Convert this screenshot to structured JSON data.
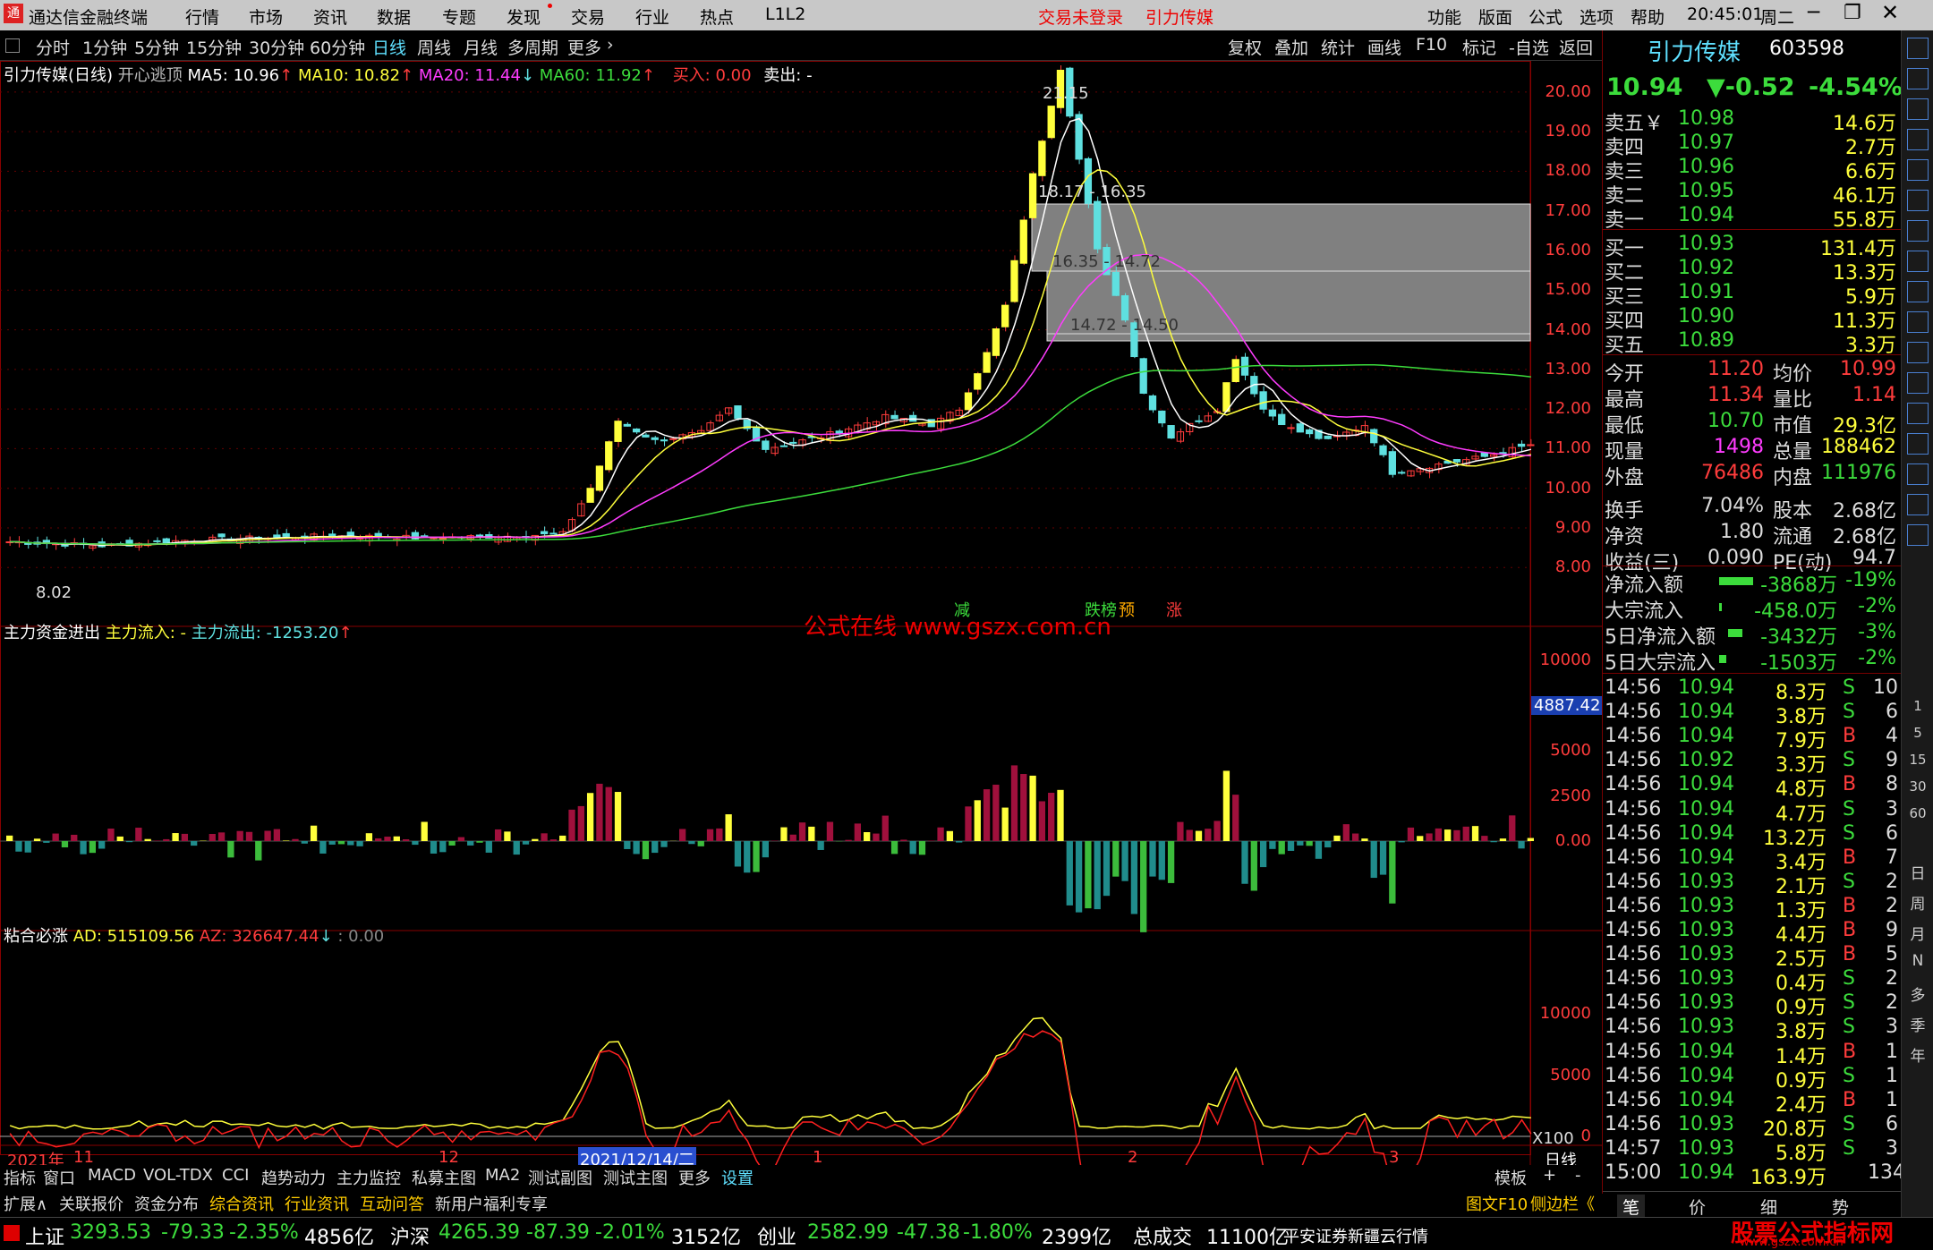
{
  "titlebar": {
    "app_title": "通达信金融终端",
    "menu": [
      "行情",
      "市场",
      "资讯",
      "数据",
      "专题",
      "发现",
      "交易",
      "行业",
      "热点",
      "L1L2"
    ],
    "login": "交易未登录",
    "stock_name": "引力传媒",
    "right_menu": [
      "功能",
      "版面",
      "公式",
      "选项",
      "帮助"
    ],
    "clock": "20:45:01",
    "weekday": "周二"
  },
  "period_tabs": [
    "分时",
    "1分钟",
    "5分钟",
    "15分钟",
    "30分钟",
    "60分钟",
    "日线",
    "周线",
    "月线",
    "多周期",
    "更多"
  ],
  "right_tabs": [
    "复权",
    "叠加",
    "统计",
    "画线",
    "F10",
    "标记",
    "-自选",
    "返回"
  ],
  "main_legend": {
    "name": "引力传媒(日线)",
    "formula": "开心逃顶",
    "ma5": "MA5: 10.96",
    "ma10": "MA10: 10.82",
    "ma20": "MA20: 11.44",
    "ma60": "MA60: 11.92",
    "buy": "买入: 0.00",
    "sell": "卖出: -"
  },
  "price_annotations": {
    "high": "21.15",
    "low": "8.02",
    "gap1": "18.17 - 16.35",
    "gap2": "16.35 - 14.72",
    "gap3": "14.72 - 14.50",
    "tag_jian": "减",
    "tag_die": "跌榜",
    "tag_yu": "预",
    "tag_zhang": "涨"
  },
  "price_axis": [
    "20.00",
    "19.00",
    "18.00",
    "17.00",
    "16.00",
    "15.00",
    "14.00",
    "13.00",
    "12.00",
    "11.00",
    "10.00",
    "9.00",
    "8.00"
  ],
  "watermark": "公式在线 www.gszx.com.cn",
  "sub1_legend": {
    "name": "主力资金进出",
    "inflow": "主力流入: -",
    "outflow": "主力流出: -1253.20"
  },
  "sub1_axis": [
    "10000",
    "7500",
    "5000",
    "2500",
    "0.00"
  ],
  "sub1_marker": "4887.42",
  "sub2_legend": {
    "name": "粘合必涨",
    "ad": "AD: 515109.56",
    "az": "AZ: 326647.44",
    "extra": ": 0.00"
  },
  "sub2_axis": [
    "10000",
    "5000",
    "0"
  ],
  "sub2_scale": "X100",
  "date_axis": {
    "year": "2021年",
    "m11": "11",
    "m12": "12",
    "cursor": "2021/12/14/二",
    "m1": "1",
    "m2": "2",
    "m3": "3",
    "period": "日线"
  },
  "bottom_tabs1": [
    "指标",
    "窗口",
    "MACD",
    "VOL-TDX",
    "CCI",
    "趋势动力",
    "主力监控",
    "私募主图",
    "MA2",
    "测试副图",
    "测试主图",
    "更多",
    "设置"
  ],
  "bottom_tabs1_right": [
    "模板",
    "+",
    "-"
  ],
  "bottom_tabs2": [
    "扩展∧",
    "关联报价",
    "资金分布",
    "综合资讯",
    "行业资讯",
    "互动问答",
    "新用户福利专享"
  ],
  "bottom_tabs2_right": [
    "图文F10",
    "侧边栏《"
  ],
  "right_bottom_tabs": [
    "笔",
    "价",
    "细",
    "势"
  ],
  "quote": {
    "name": "引力传媒",
    "code": "603598",
    "price": "10.94",
    "change": "▼-0.52",
    "pct": "-4.54%"
  },
  "asks": [
    [
      "卖五￥",
      "10.98",
      "14.6万"
    ],
    [
      "卖四",
      "10.97",
      "2.7万"
    ],
    [
      "卖三",
      "10.96",
      "6.6万"
    ],
    [
      "卖二",
      "10.95",
      "46.1万"
    ],
    [
      "卖一",
      "10.94",
      "55.8万"
    ]
  ],
  "bids": [
    [
      "买一",
      "10.93",
      "131.4万"
    ],
    [
      "买二",
      "10.92",
      "13.3万"
    ],
    [
      "买三",
      "10.91",
      "5.9万"
    ],
    [
      "买四",
      "10.90",
      "11.3万"
    ],
    [
      "买五",
      "10.89",
      "3.3万"
    ]
  ],
  "stats": [
    [
      "今开",
      "11.20",
      "均价",
      "10.99"
    ],
    [
      "最高",
      "11.34",
      "量比",
      "1.14"
    ],
    [
      "最低",
      "10.70",
      "市值",
      "29.3亿"
    ],
    [
      "现量",
      "1498",
      "总量",
      "188462"
    ],
    [
      "外盘",
      "76486",
      "内盘",
      "111976"
    ],
    [
      "换手",
      "7.04%",
      "股本",
      "2.68亿"
    ],
    [
      "净资",
      "1.80",
      "流通",
      "2.68亿"
    ],
    [
      "收益(三)",
      "0.090",
      "PE(动)",
      "94.7"
    ]
  ],
  "flows": [
    [
      "净流入额",
      "-3868万",
      "-19%"
    ],
    [
      "大宗流入",
      "-458.0万",
      "-2%"
    ],
    [
      "5日净流入额",
      "-3432万",
      "-3%"
    ],
    [
      "5日大宗流入",
      "-1503万",
      "-2%"
    ]
  ],
  "ticks": [
    [
      "14:56",
      "10.94",
      "8.3万",
      "S",
      "10"
    ],
    [
      "14:56",
      "10.94",
      "3.8万",
      "S",
      "6"
    ],
    [
      "14:56",
      "10.94",
      "7.9万",
      "B",
      "4"
    ],
    [
      "14:56",
      "10.92",
      "3.3万",
      "S",
      "9"
    ],
    [
      "14:56",
      "10.94",
      "4.8万",
      "B",
      "8"
    ],
    [
      "14:56",
      "10.94",
      "4.7万",
      "S",
      "3"
    ],
    [
      "14:56",
      "10.94",
      "13.2万",
      "S",
      "6"
    ],
    [
      "14:56",
      "10.94",
      "3.4万",
      "B",
      "7"
    ],
    [
      "14:56",
      "10.93",
      "2.1万",
      "S",
      "2"
    ],
    [
      "14:56",
      "10.93",
      "1.3万",
      "B",
      "2"
    ],
    [
      "14:56",
      "10.93",
      "4.4万",
      "B",
      "9"
    ],
    [
      "14:56",
      "10.93",
      "2.5万",
      "B",
      "5"
    ],
    [
      "14:56",
      "10.93",
      "0.4万",
      "S",
      "2"
    ],
    [
      "14:56",
      "10.93",
      "0.9万",
      "S",
      "2"
    ],
    [
      "14:56",
      "10.93",
      "3.8万",
      "S",
      "3"
    ],
    [
      "14:56",
      "10.94",
      "1.4万",
      "B",
      "1"
    ],
    [
      "14:56",
      "10.94",
      "0.9万",
      "S",
      "1"
    ],
    [
      "14:56",
      "10.94",
      "2.4万",
      "B",
      "1"
    ],
    [
      "14:56",
      "10.93",
      "20.8万",
      "S",
      "6"
    ],
    [
      "14:57",
      "10.93",
      "5.8万",
      "S",
      "3"
    ],
    [
      "15:00",
      "10.94",
      "163.9万",
      "",
      "134"
    ]
  ],
  "side_icons": [
    "日",
    "周",
    "月",
    "N",
    "多",
    "季",
    "年"
  ],
  "side_icons_top": [
    "1",
    "5",
    "15",
    "30",
    "60"
  ],
  "status": {
    "sh": "上证",
    "sh_v": "3293.53",
    "sh_c": "-79.33",
    "sh_p": "-2.35%",
    "sh_a": "4856亿",
    "hs": "沪深",
    "hs_v": "4265.39",
    "hs_c": "-87.39",
    "hs_p": "-2.01%",
    "hs_a": "3152亿",
    "cy": "创业",
    "cy_v": "2582.99",
    "cy_c": "-47.38",
    "cy_p": "-1.80%",
    "cy_a": "2399亿",
    "total": "总成交",
    "total_v": "11100亿",
    "broker": "平安证券新疆云行情",
    "logo": "股票公式指标网",
    "logo_url": "www.gszx.com.cn"
  },
  "colors": {
    "up": "#ff3c3c",
    "down": "#5fe0e0",
    "yellow": "#ffff3c",
    "ma5": "#ffffff",
    "ma10": "#ffff3c",
    "ma20": "#ff3cff",
    "ma60": "#3cdc3c"
  }
}
